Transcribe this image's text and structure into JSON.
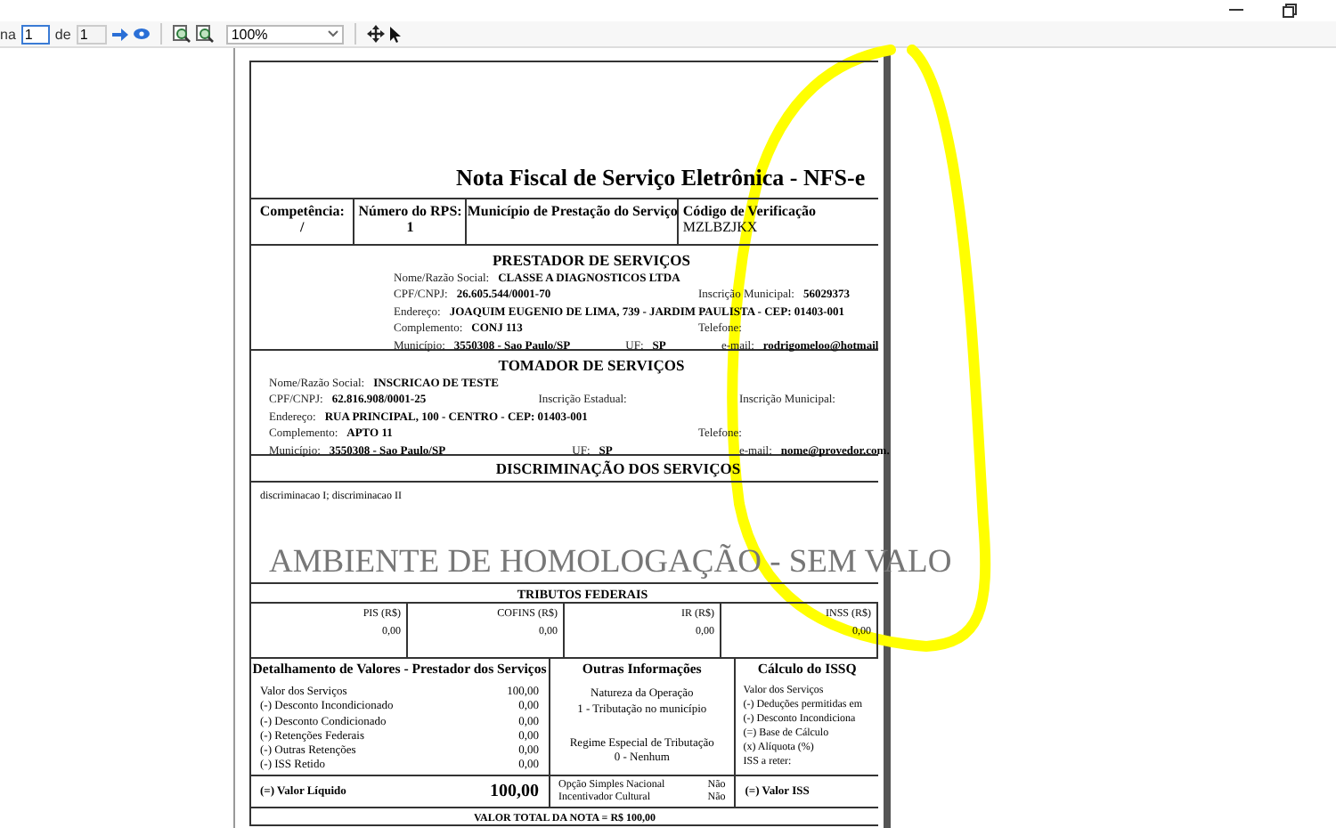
{
  "toolbar": {
    "page_label": "na",
    "page": "1",
    "of_label": "de",
    "page_count": "1",
    "zoom": "100%"
  },
  "document": {
    "title": "Nota Fiscal de Serviço Eletrônica - NFS-e",
    "header_fields": [
      {
        "label": "Competência:",
        "value": "/"
      },
      {
        "label": "Número do RPS:",
        "value": "1"
      },
      {
        "label": "Município de Prestação do Serviço"
      },
      {
        "label": "Código de Verificação",
        "value": "MZLBZJKX"
      }
    ],
    "sections": [
      {
        "heading": "PRESTADOR DE SERVIÇOS",
        "rows": [
          [
            {
              "label": "Nome/Razão Social:",
              "value": "CLASSE A DIAGNOSTICOS LTDA"
            }
          ],
          [
            {
              "label": "CPF/CNPJ:",
              "value": "26.605.544/0001-70"
            },
            {
              "label": "Inscrição Municipal:",
              "value": "56029373"
            }
          ],
          [
            {
              "label": "Endereço:",
              "value": "JOAQUIM EUGENIO DE LIMA, 739 - JARDIM PAULISTA - CEP: 01403-001"
            }
          ],
          [
            {
              "label": "Complemento:",
              "value": "CONJ 113"
            },
            {
              "label": "Telefone:"
            }
          ],
          [
            {
              "label": "Município:",
              "value": "3550308 - Sao Paulo/SP"
            },
            {
              "label": "UF:",
              "value": "SP"
            },
            {
              "label": "e-mail:",
              "value": "rodrigomeloo@hotmail"
            }
          ]
        ]
      },
      {
        "heading": "TOMADOR DE SERVIÇOS",
        "rows": [
          [
            {
              "label": "Nome/Razão Social:",
              "value": "INSCRICAO DE TESTE"
            }
          ],
          [
            {
              "label": "CPF/CNPJ:",
              "value": "62.816.908/0001-25"
            },
            {
              "label": "Inscrição Estadual:"
            },
            {
              "label": "Inscrição Municipal:"
            }
          ],
          [
            {
              "label": "Endereço:",
              "value": "RUA PRINCIPAL, 100 - CENTRO - CEP: 01403-001"
            }
          ],
          [
            {
              "label": "Complemento:",
              "value": "APTO 11"
            },
            {
              "label": "Telefone:"
            }
          ],
          [
            {
              "label": "Município:",
              "value": "3550308 - Sao Paulo/SP"
            },
            {
              "label": "UF:",
              "value": "SP"
            },
            {
              "label": "e-mail:",
              "value": "nome@provedor.com."
            }
          ]
        ]
      }
    ],
    "services": {
      "heading": "DISCRIMINAÇÃO DOS SERVIÇOS",
      "text": "discriminacao I; discriminacao II"
    },
    "watermark": "AMBIENTE DE HOMOLOGAÇÃO - SEM VALO",
    "federal_taxes": {
      "heading": "TRIBUTOS FEDERAIS",
      "columns": [
        {
          "label": "PIS (R$)",
          "value": "0,00"
        },
        {
          "label": "COFINS (R$)",
          "value": "0,00"
        },
        {
          "label": "IR (R$)",
          "value": "0,00"
        },
        {
          "label": "INSS (R$)",
          "value": "0,00"
        }
      ]
    },
    "values_detail": {
      "title": "Detalhamento de Valores - Prestador dos Serviços",
      "items": [
        {
          "label": "Valor dos Serviços",
          "value": "100,00"
        },
        {
          "label": "(-) Desconto Incondicionado",
          "value": "0,00"
        },
        {
          "label": "(-) Desconto Condicionado",
          "value": "0,00"
        },
        {
          "label": "(-) Retenções Federais",
          "value": "0,00"
        },
        {
          "label": "(-) Outras Retenções",
          "value": "0,00"
        },
        {
          "label": "(-) ISS Retido",
          "value": "0,00"
        }
      ],
      "total": {
        "label": "(=) Valor Líquido",
        "value": "100,00"
      }
    },
    "other_info": {
      "title": "Outras Informações",
      "lines": [
        "Natureza da Operação",
        "1 - Tributação no município",
        "Regime Especial de Tributação",
        "0 - Nenhum"
      ],
      "options": [
        {
          "label": "Opção Simples Nacional",
          "value": "Não"
        },
        {
          "label": "Incentivador Cultural",
          "value": "Não"
        }
      ]
    },
    "iss_calc": {
      "title": "Cálculo do ISSQ",
      "items": [
        "Valor dos Serviços",
        "(-) Deduções permitidas em",
        "(-) Desconto Incondiciona",
        "(=) Base de Cálculo",
        "(x) Alíquota (%)",
        "ISS a reter:"
      ],
      "total_label": "(=) Valor ISS"
    },
    "footer": "VALOR TOTAL DA NOTA = R$ 100,00"
  }
}
